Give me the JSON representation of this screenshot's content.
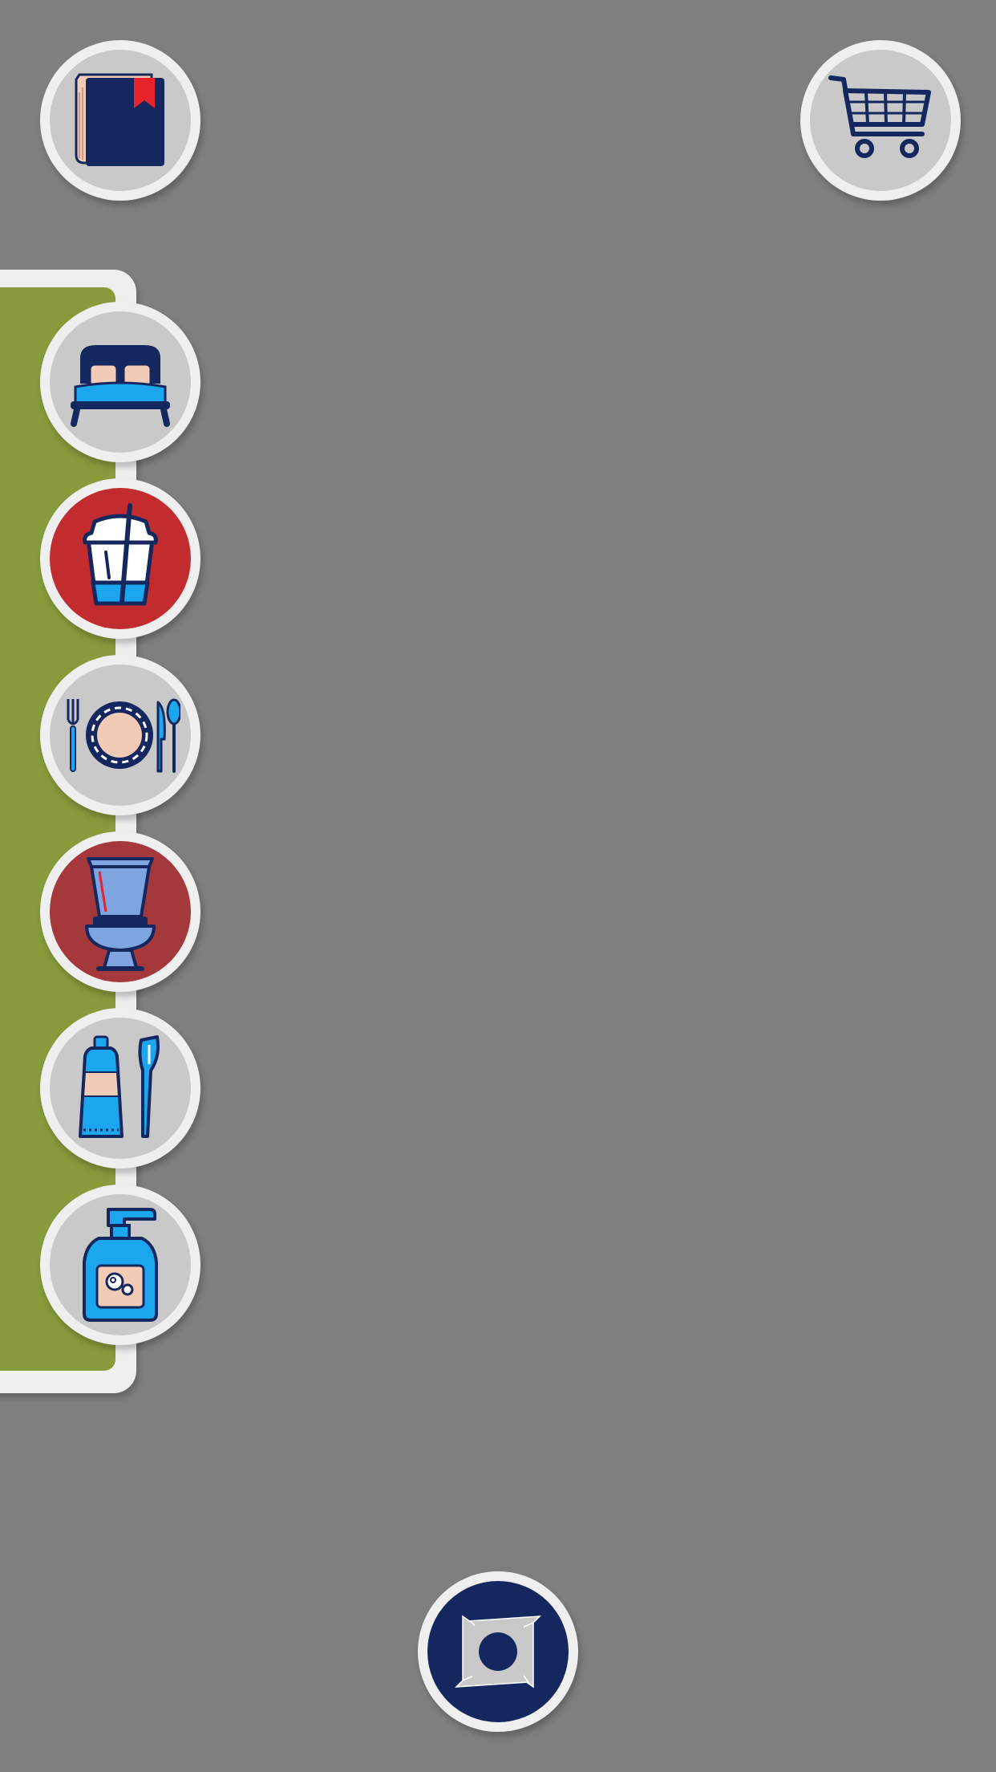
{
  "topbar": {
    "left_icon": "book-icon",
    "right_icon": "shopping-cart-icon"
  },
  "categories": [
    {
      "id": "bedroom",
      "icon": "bed-icon",
      "selected": false,
      "face_color": "#c9c9c9"
    },
    {
      "id": "drinks",
      "icon": "drink-cup-icon",
      "selected": true,
      "face_color": "#c22c2e"
    },
    {
      "id": "dining",
      "icon": "plate-cutlery-icon",
      "selected": false,
      "face_color": "#c9c9c9"
    },
    {
      "id": "toilet",
      "icon": "toilet-icon",
      "selected": true,
      "face_color": "#a4383a"
    },
    {
      "id": "dental",
      "icon": "toothpaste-toothbrush-icon",
      "selected": false,
      "face_color": "#c9c9c9"
    },
    {
      "id": "soap",
      "icon": "soap-dispenser-icon",
      "selected": false,
      "face_color": "#c9c9c9"
    }
  ],
  "bottom": {
    "icon": "camera-shutter-icon"
  },
  "colors": {
    "background": "#7f7f7f",
    "panel_green": "#879b3c",
    "button_rim": "#efefef",
    "button_face": "#c9c9c9",
    "navy": "#14275e",
    "sky_blue": "#1ba6ee",
    "peach": "#f2cbb6",
    "accent_red": "#c22c2e"
  }
}
